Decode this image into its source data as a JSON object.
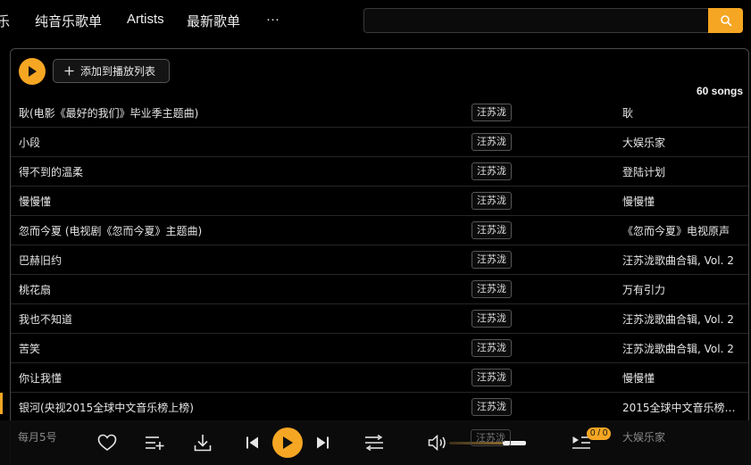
{
  "nav": {
    "items": [
      {
        "label": "乐"
      },
      {
        "label": "纯音乐歌单"
      },
      {
        "label": "Artists"
      },
      {
        "label": "最新歌单"
      },
      {
        "label": "···"
      }
    ]
  },
  "search": {
    "value": "",
    "icon": "search-icon"
  },
  "toolbar": {
    "add_to_playlist_label": "添加到播放列表",
    "song_count": "60 songs"
  },
  "songs": [
    {
      "title": "耿(电影《最好的我们》毕业季主题曲)",
      "artist": "汪苏泷",
      "album": "耿"
    },
    {
      "title": "小段",
      "artist": "汪苏泷",
      "album": "大娱乐家"
    },
    {
      "title": "得不到的温柔",
      "artist": "汪苏泷",
      "album": "登陆计划"
    },
    {
      "title": "慢慢懂",
      "artist": "汪苏泷",
      "album": "慢慢懂"
    },
    {
      "title": "忽而今夏 (电视剧《忽而今夏》主题曲)",
      "artist": "汪苏泷",
      "album": "《忽而今夏》电视原声"
    },
    {
      "title": "巴赫旧约",
      "artist": "汪苏泷",
      "album": "汪苏泷歌曲合辑, Vol. 2"
    },
    {
      "title": "桃花扇",
      "artist": "汪苏泷",
      "album": "万有引力"
    },
    {
      "title": "我也不知道",
      "artist": "汪苏泷",
      "album": "汪苏泷歌曲合辑, Vol. 2"
    },
    {
      "title": "苦笑",
      "artist": "汪苏泷",
      "album": "汪苏泷歌曲合辑, Vol. 2"
    },
    {
      "title": "你让我懂",
      "artist": "汪苏泷",
      "album": "慢慢懂"
    },
    {
      "title": "银河(央视2015全球中文音乐榜上榜)",
      "artist": "汪苏泷",
      "album": "2015全球中文音乐榜上..."
    }
  ],
  "player": {
    "now_playing": "每月5号",
    "behind_artist": "汪苏泷",
    "behind_album": "大娱乐家",
    "queue_badge": "0 / 0",
    "volume_fraction": 0.7
  },
  "colors": {
    "accent": "#f5a623",
    "background": "#000000",
    "text": "#e6e6e6"
  }
}
